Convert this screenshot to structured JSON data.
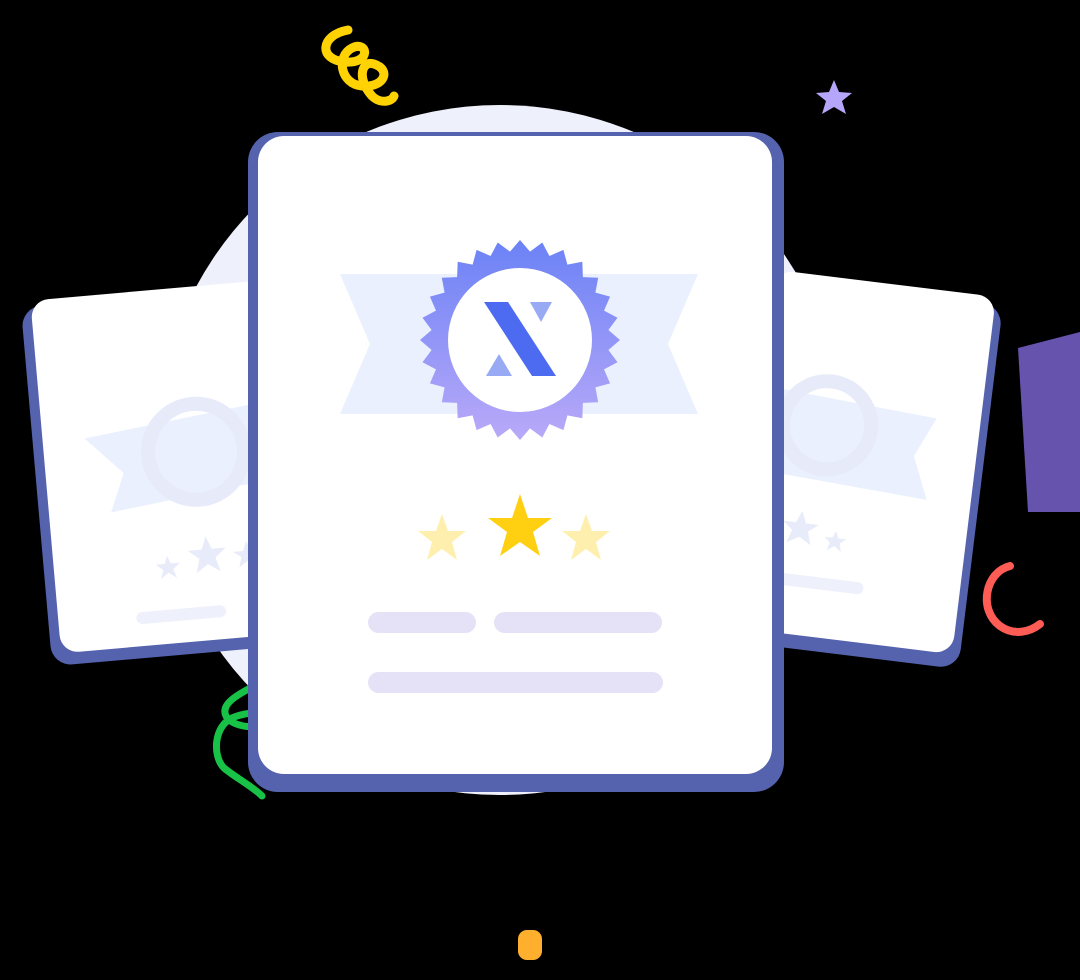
{
  "illustration": {
    "colors": {
      "background": "#000000",
      "halo": "#EEF0FB",
      "card_face": "#FFFFFF",
      "card_shadow": "#5562AE",
      "ribbon": "#EAF0FD",
      "seal_gradient_start": "#6B82F6",
      "seal_gradient_end": "#B9A9F8",
      "logo_mark": "#4D6BF0",
      "logo_mark_light": "#98AAF4",
      "star_filled": "#FFCF11",
      "star_faded": "#FFEFAE",
      "text_placeholder": "#E5E2F8",
      "side_card_ring": "#E6EAF9",
      "side_card_star": "#E8ECFA",
      "confetti_yellow": "#FFD204",
      "confetti_purple": "#B5A6FB",
      "confetti_violet": "#6553AE",
      "confetti_red": "#FF5C56",
      "confetti_green": "#17C247",
      "confetti_orange": "#FFAF2E"
    },
    "icons": [
      "award-seal-icon",
      "x-logo-icon",
      "star-icon"
    ],
    "main_card_rating": {
      "highlighted": 1,
      "total": 3
    },
    "left_card_rating": {
      "total": 3
    },
    "right_card_rating": {
      "total": 3
    }
  }
}
